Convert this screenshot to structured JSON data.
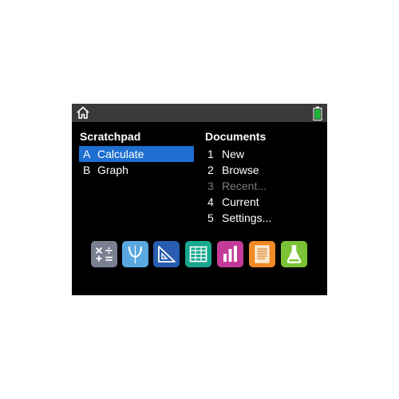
{
  "scratchpad": {
    "heading": "Scratchpad",
    "items": [
      {
        "key": "A",
        "label": "Calculate",
        "selected": true
      },
      {
        "key": "B",
        "label": "Graph",
        "selected": false
      }
    ]
  },
  "documents": {
    "heading": "Documents",
    "items": [
      {
        "key": "1",
        "label": "New",
        "enabled": true
      },
      {
        "key": "2",
        "label": "Browse",
        "enabled": true
      },
      {
        "key": "3",
        "label": "Recent...",
        "enabled": false
      },
      {
        "key": "4",
        "label": "Current",
        "enabled": true
      },
      {
        "key": "5",
        "label": "Settings...",
        "enabled": true
      }
    ]
  },
  "status_bar": {
    "left_icon": "home-icon",
    "right_icon": "battery-icon",
    "battery_color": "#1fb53a"
  },
  "apps": [
    {
      "icon": "calculator-icon",
      "color": "#7a7f91"
    },
    {
      "icon": "graphs-icon",
      "color": "#5aa8e0"
    },
    {
      "icon": "geometry-icon",
      "color": "#2a5db0"
    },
    {
      "icon": "lists-spreadsheet-icon",
      "color": "#1aa88e"
    },
    {
      "icon": "data-statistics-icon",
      "color": "#c43a98"
    },
    {
      "icon": "notes-icon",
      "color": "#f08a24"
    },
    {
      "icon": "vernier-dataquest-icon",
      "color": "#7cc236"
    }
  ],
  "colors": {
    "screen_background": "#000000",
    "selection": "#1e6fcf",
    "disabled_text": "#7c7c7c"
  }
}
